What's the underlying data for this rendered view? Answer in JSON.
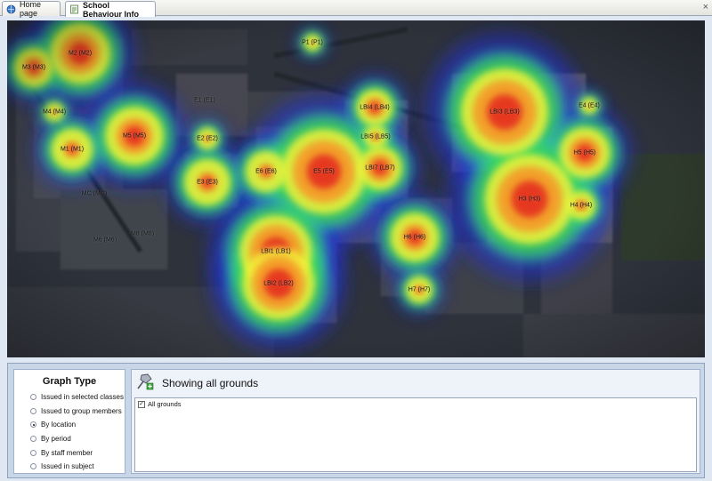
{
  "tabs": [
    {
      "label": "Home page",
      "icon": "home-page-icon"
    },
    {
      "label": "School Behaviour Info",
      "icon": "report-icon"
    }
  ],
  "close_glyph": "×",
  "map": {
    "icon": "heatmap-icon",
    "hotspots": [
      {
        "label": "M2 (M2)",
        "intensity": 0.9
      },
      {
        "label": "M3 (M3)",
        "intensity": 0.75
      },
      {
        "label": "M4 (M4)",
        "intensity": 0.4
      },
      {
        "label": "M1 (M1)",
        "intensity": 0.55
      },
      {
        "label": "M5 (M5)",
        "intensity": 0.85
      },
      {
        "label": "MC (MC)",
        "intensity": 0.0
      },
      {
        "label": "M6 (M6)",
        "intensity": 0.0
      },
      {
        "label": "M8 (M8)",
        "intensity": 0.0
      },
      {
        "label": "P1 (P1)",
        "intensity": 0.25
      },
      {
        "label": "E1 (E1)",
        "intensity": 0.05
      },
      {
        "label": "E2 (E2)",
        "intensity": 0.45
      },
      {
        "label": "E3 (E3)",
        "intensity": 0.6
      },
      {
        "label": "E6 (E6)",
        "intensity": 0.5
      },
      {
        "label": "E5 (E5)",
        "intensity": 1.0
      },
      {
        "label": "LBI4 (LB4)",
        "intensity": 0.75
      },
      {
        "label": "LBI5 (LB5)",
        "intensity": 0.5
      },
      {
        "label": "LBI7 (LB7)",
        "intensity": 0.85
      },
      {
        "label": "LBI1 (LB1)",
        "intensity": 1.0
      },
      {
        "label": "LBI2 (LB2)",
        "intensity": 1.0
      },
      {
        "label": "H6 (H6)",
        "intensity": 0.75
      },
      {
        "label": "H7 (H7)",
        "intensity": 0.5
      },
      {
        "label": "LBI3 (LB3)",
        "intensity": 1.0
      },
      {
        "label": "E4 (E4)",
        "intensity": 0.35
      },
      {
        "label": "H5 (H5)",
        "intensity": 0.85
      },
      {
        "label": "H3 (H3)",
        "intensity": 1.0
      },
      {
        "label": "H4 (H4)",
        "intensity": 0.55
      }
    ]
  },
  "graph_type": {
    "title": "Graph Type",
    "options": [
      {
        "label": "Issued in selected classes",
        "checked": false
      },
      {
        "label": "Issued to group members",
        "checked": false
      },
      {
        "label": "By location",
        "checked": true
      },
      {
        "label": "By period",
        "checked": false
      },
      {
        "label": "By staff member",
        "checked": false
      },
      {
        "label": "Issued in subject",
        "checked": false
      }
    ]
  },
  "grounds": {
    "title": "Showing all grounds",
    "icon": "pin-add-icon",
    "items": [
      {
        "label": "All grounds",
        "checked": true
      }
    ]
  }
}
